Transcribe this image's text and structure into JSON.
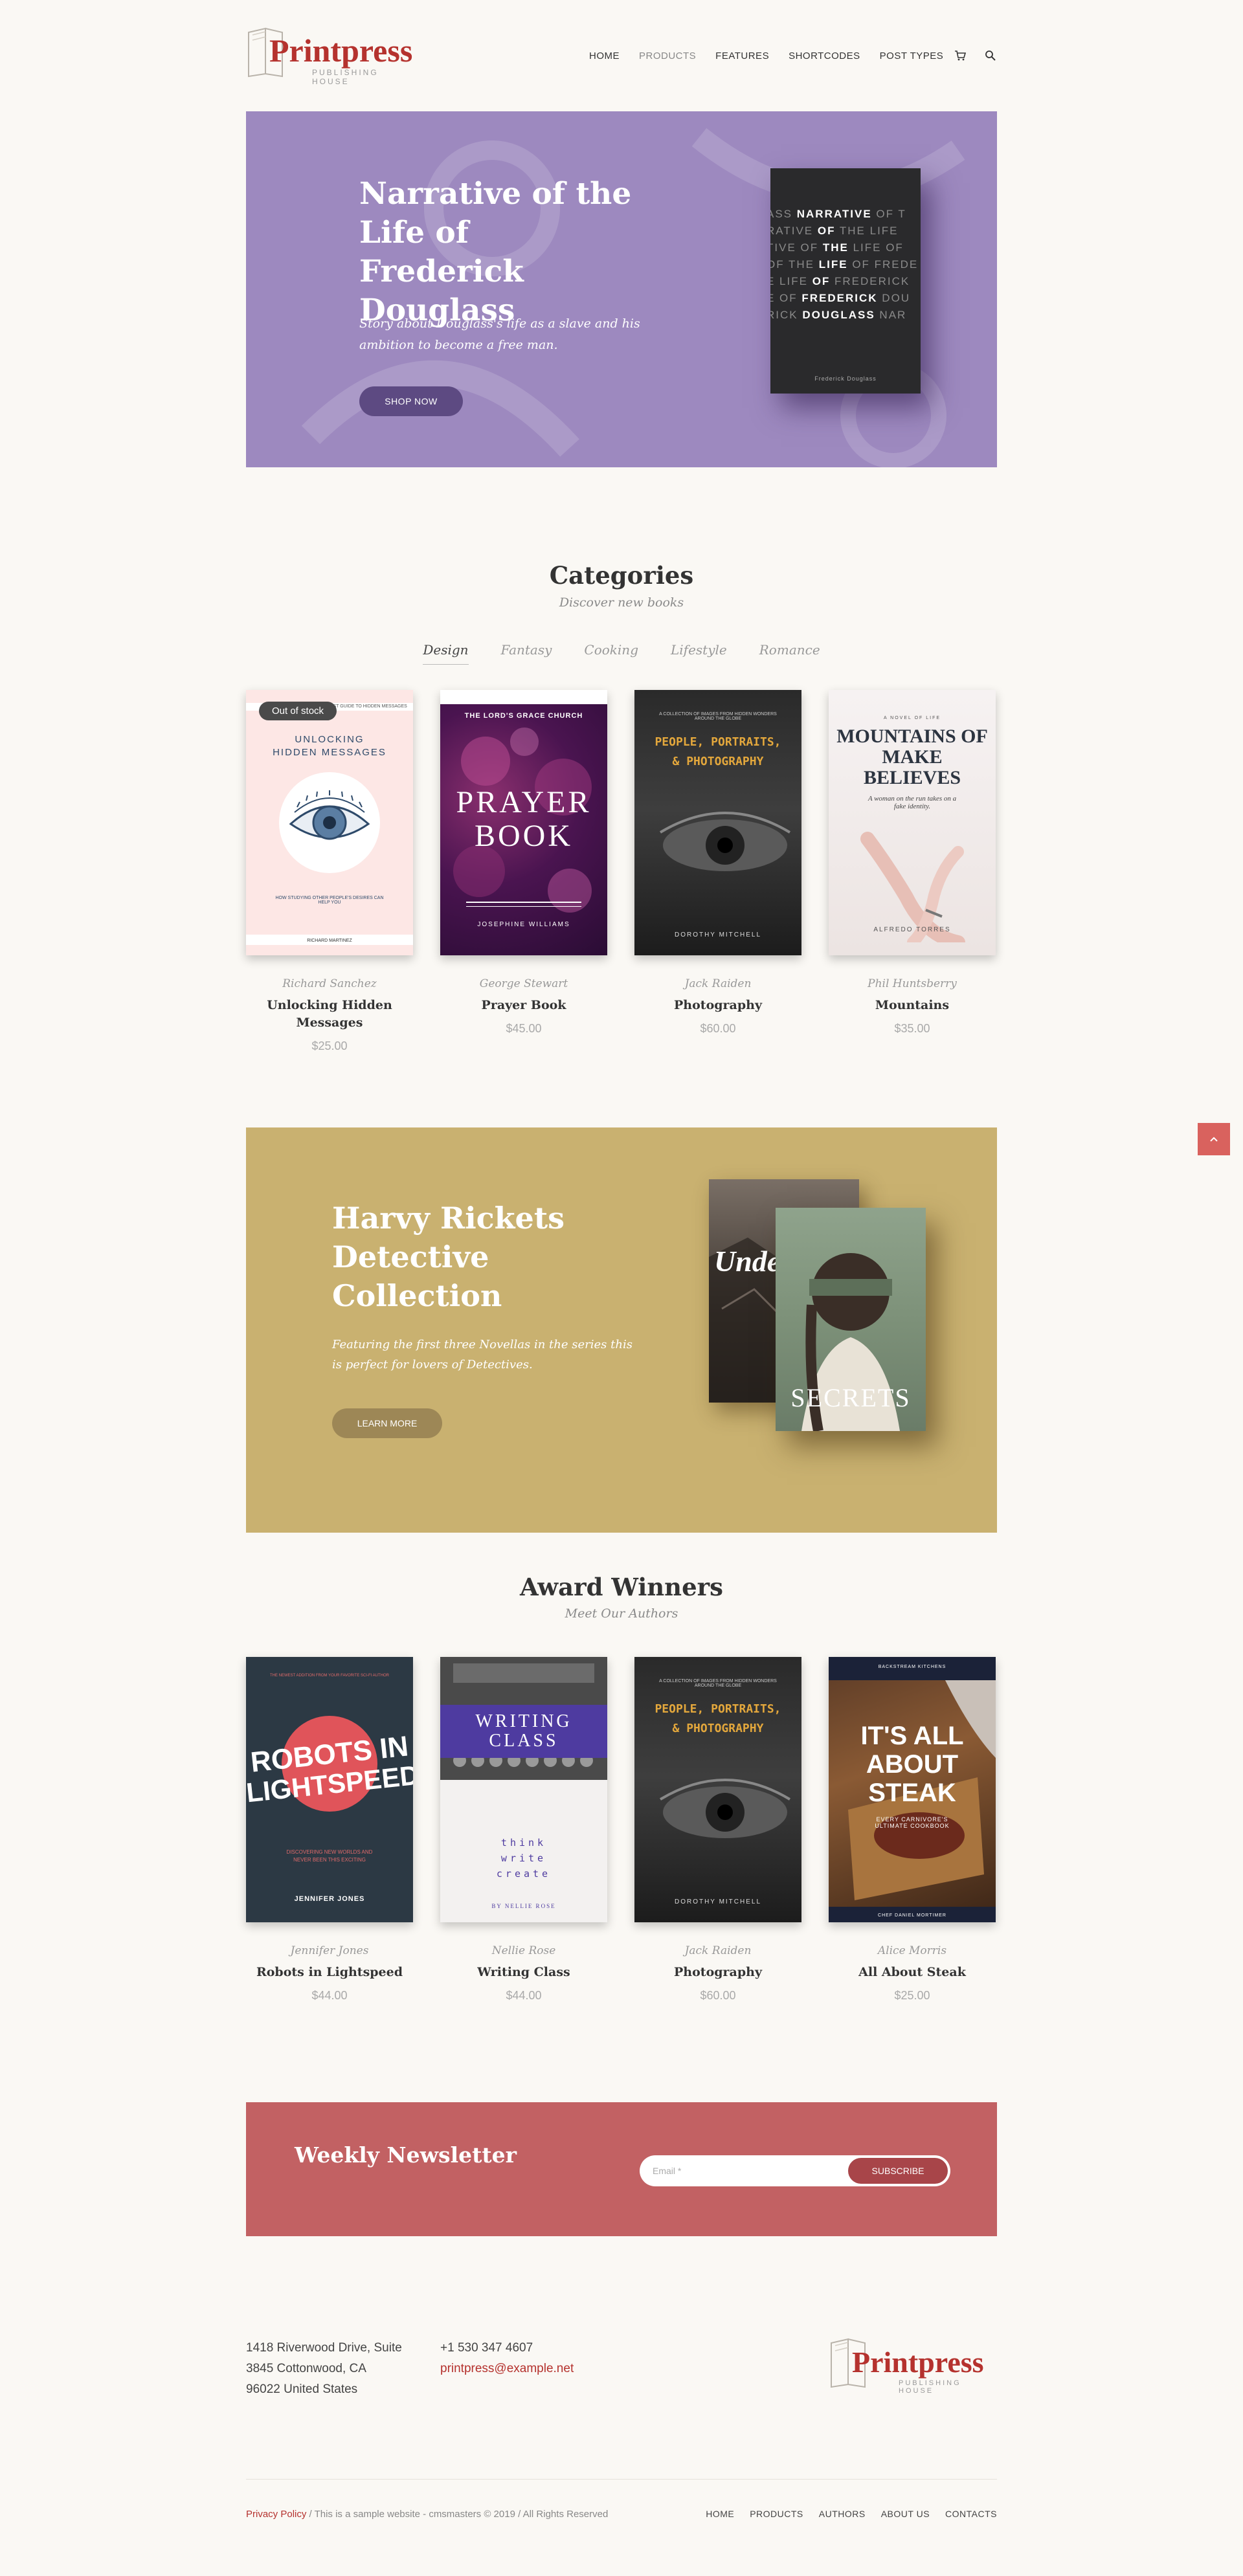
{
  "header": {
    "logo_name": "Printpress",
    "logo_sub": "PUBLISHING HOUSE",
    "nav": [
      "HOME",
      "PRODUCTS",
      "FEATURES",
      "SHORTCODES",
      "POST TYPES"
    ],
    "active_nav": "PRODUCTS",
    "icons": [
      "cart-icon",
      "search-icon"
    ]
  },
  "hero": {
    "title": "Narrative of the Life of Frederick Douglass",
    "text": "Story about Douglass's life as a slave and his ambition to become a free man.",
    "button": "SHOP NOW",
    "background": "#9d89bf",
    "book_author": "Frederick Douglass"
  },
  "categories": {
    "title": "Categories",
    "subtitle": "Discover new books",
    "tabs": [
      "Design",
      "Fantasy",
      "Cooking",
      "Lifestyle",
      "Romance"
    ],
    "active_tab": "Design",
    "products": [
      {
        "author": "Richard Sanchez",
        "title": "Unlocking Hidden Messages",
        "price": "$25.00",
        "badge": "Out of stock",
        "cover": {
          "top": "UNLOCKING",
          "bottom": "HIDDEN MESSAGES",
          "tagline": "HOW STUDYING OTHER PEOPLE'S DESIRES CAN HELP YOU",
          "author": "RICHARD MARTINEZ",
          "header": "THE BEST GUIDE TO HIDDEN MESSAGES"
        }
      },
      {
        "author": "George Stewart",
        "title": "Prayer Book",
        "price": "$45.00",
        "cover": {
          "header": "THE LORD'S GRACE CHURCH",
          "line1": "PRAYER",
          "line2": "BOOK",
          "author": "JOSEPHINE WILLIAMS"
        }
      },
      {
        "author": "Jack Raiden",
        "title": "Photography",
        "price": "$60.00",
        "cover": {
          "header": "A COLLECTION OF IMAGES FROM HIDDEN WONDERS AROUND THE GLOBE",
          "headline": "PEOPLE, PORTRAITS, & PHOTOGRAPHY",
          "author": "DOROTHY MITCHELL"
        }
      },
      {
        "author": "Phil Huntsberry",
        "title": "Mountains",
        "price": "$35.00",
        "cover": {
          "header": "A NOVEL OF LIFE",
          "headline": "MOUNTAINS OF MAKE BELIEVES",
          "tagline": "A woman on the run takes on a fake identity.",
          "author": "ALFREDO TORRES"
        }
      }
    ]
  },
  "harvy": {
    "title": "Harvy Rickets Detective Collection",
    "text": "Featuring the first three Novellas in the series this is perfect for lovers of Detectives.",
    "button": "LEARN MORE",
    "background": "#c9b170",
    "book_back": "Under",
    "book_front": "SECRETS"
  },
  "awards": {
    "title": "Award Winners",
    "subtitle": "Meet Our Authors",
    "products": [
      {
        "author": "Jennifer Jones",
        "title": "Robots in Lightspeed",
        "price": "$44.00",
        "cover": {
          "header": "THE NEWEST ADDITION FROM YOUR FAVORITE SCI-FI AUTHOR",
          "line1": "ROBOTS IN",
          "line2": "LIGHTSPEED",
          "tagline": "DISCOVERING NEW WORLDS AND NEVER BEEN THIS EXCITING",
          "author": "JENNIFER JONES"
        }
      },
      {
        "author": "Nellie Rose",
        "title": "Writing Class",
        "price": "$44.00",
        "cover": {
          "line1": "WRITING",
          "line2": "CLASS",
          "words": [
            "think",
            "write",
            "create"
          ],
          "author": "BY NELLIE ROSE"
        }
      },
      {
        "author": "Jack Raiden",
        "title": "Photography",
        "price": "$60.00",
        "cover": {
          "header": "A COLLECTION OF IMAGES FROM HIDDEN WONDERS AROUND THE GLOBE",
          "headline": "PEOPLE, PORTRAITS, & PHOTOGRAPHY",
          "author": "DOROTHY MITCHELL"
        }
      },
      {
        "author": "Alice Morris",
        "title": "All About Steak",
        "price": "$25.00",
        "cover": {
          "header": "BACKSTREAM KITCHENS",
          "line1": "IT'S ALL",
          "line2": "ABOUT",
          "line3": "STEAK",
          "tagline": "EVERY CARNIVORE'S ULTIMATE COOKBOOK",
          "author": "CHEF DANIEL MORTIMER"
        }
      }
    ]
  },
  "newsletter": {
    "title": "Weekly Newsletter",
    "placeholder": "Email *",
    "button": "SUBSCRIBE"
  },
  "footer": {
    "address": [
      "1418 Riverwood Drive, Suite",
      "3845 Cottonwood, CA",
      "96022 United States"
    ],
    "phone": "+1 530 347 4607",
    "email": "printpress@example.net",
    "privacy": "Privacy Policy",
    "copyright": " / This is a sample website - cmsmasters © 2019 / All Rights Reserved",
    "nav": [
      "HOME",
      "PRODUCTS",
      "AUTHORS",
      "ABOUT US",
      "CONTACTS"
    ]
  },
  "colors": {
    "brand": "#b5322e",
    "hero": "#9d89bf",
    "harvy": "#c9b170",
    "newsletter": "#c26163",
    "scroll_top": "#d9625e"
  }
}
